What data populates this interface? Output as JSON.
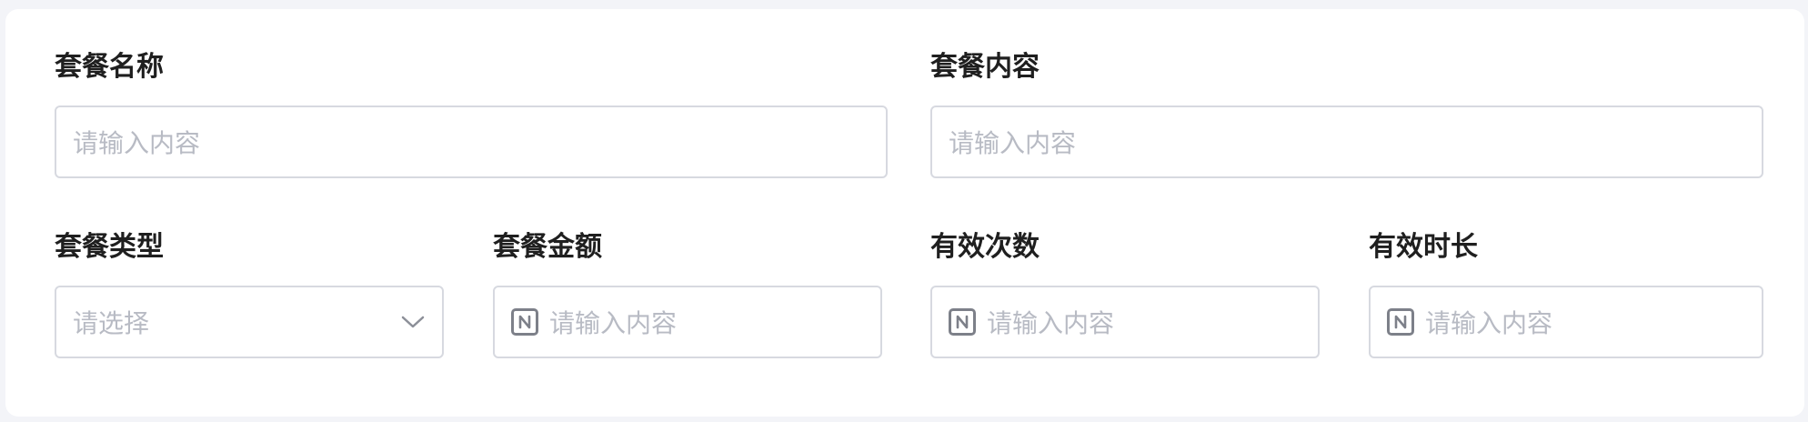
{
  "form": {
    "name": {
      "label": "套餐名称",
      "placeholder": "请输入内容"
    },
    "content": {
      "label": "套餐内容",
      "placeholder": "请输入内容"
    },
    "type": {
      "label": "套餐类型",
      "placeholder": "请选择",
      "icon": "chevron-down-icon"
    },
    "amount": {
      "label": "套餐金额",
      "placeholder": "请输入内容",
      "icon": "number-icon"
    },
    "valid_count": {
      "label": "有效次数",
      "placeholder": "请输入内容",
      "icon": "number-icon"
    },
    "valid_duration": {
      "label": "有效时长",
      "placeholder": "请输入内容",
      "icon": "number-icon"
    }
  },
  "colors": {
    "label": "#1f1f1f",
    "placeholder": "#b8bbc4",
    "border": "#d7d9e0",
    "background": "#f3f4f8",
    "card": "#ffffff"
  }
}
